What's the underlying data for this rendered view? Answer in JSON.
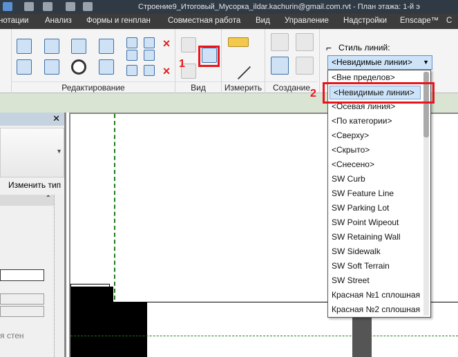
{
  "title_bar": {
    "title": "Строение9_Итоговый_Мусорка_ildar.kachurin@gmail.com.rvt - План этажа: 1-й э"
  },
  "menu": [
    "нотации",
    "Анализ",
    "Формы и генплан",
    "Совместная работа",
    "Вид",
    "Управление",
    "Надстройки",
    "Enscape™",
    "С"
  ],
  "ribbon": {
    "panels": [
      "Редактирование",
      "Вид",
      "Измерить",
      "Создание"
    ],
    "line_style_label": "Стиль линий:",
    "line_style_value": "<Невидимые линии>",
    "annotation_1": "1",
    "annotation_2": "2"
  },
  "line_style_options": [
    "<Вне пределов>",
    "<Невидимые линии>",
    "<Осевая линия>",
    "<По категории>",
    "<Сверху>",
    "<Скрыто>",
    "<Снесено>",
    "SW Curb",
    "SW Feature Line",
    "SW Parking Lot",
    "SW Point Wipeout",
    "SW Retaining Wall",
    "SW Sidewalk",
    "SW Soft Terrain",
    "SW Street",
    "Красная №1 сплошная",
    "Красная №2 сплошная"
  ],
  "selected_option": "<Невидимые линии>",
  "properties": {
    "edit_type": "Изменить тип",
    "partial_text": "я стен"
  },
  "colors": {
    "highlight": "#e8141c",
    "accent": "#cde3f8",
    "green_line": "#1a7a1a"
  }
}
